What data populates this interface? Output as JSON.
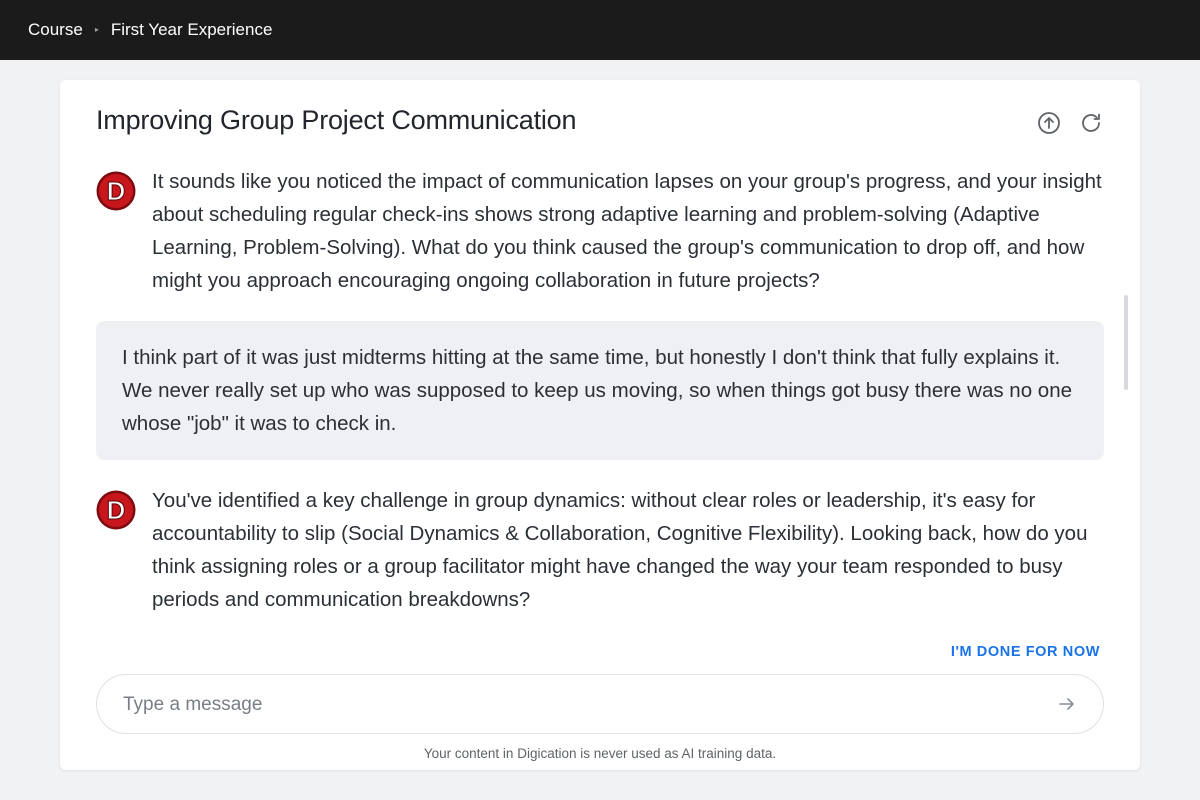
{
  "breadcrumb": {
    "items": [
      "Course",
      "First Year Experience"
    ],
    "separator": "▸"
  },
  "conversation": {
    "title": "Improving Group Project Communication",
    "header_icons": [
      "arrow-up-circle-icon",
      "refresh-icon"
    ],
    "messages": [
      {
        "role": "assistant",
        "avatar": "D",
        "text": "It sounds like you noticed the impact of communication lapses on your group's progress, and your insight about scheduling regular check-ins shows strong adaptive learning and problem-solving (Adaptive Learning, Problem-Solving). What do you think caused the group's communication to drop off, and how might you approach encouraging ongoing collaboration in future projects?"
      },
      {
        "role": "user",
        "text": "I think part of it was just midterms hitting at the same time, but honestly I don't think that fully explains it. We never really set up who was supposed to keep us moving, so when things got busy there was no one whose \"job\" it was to check in."
      },
      {
        "role": "assistant",
        "avatar": "D",
        "text": "You've identified a key challenge in group dynamics: without clear roles or leadership, it's easy for accountability to slip (Social Dynamics & Collaboration, Cognitive Flexibility). Looking back, how do you think assigning roles or a group facilitator might have changed the way your team responded to busy periods and communication breakdowns?"
      }
    ]
  },
  "actions": {
    "done_label": "I'M DONE FOR NOW"
  },
  "composer": {
    "placeholder": "Type a message",
    "value": "",
    "send_icon": "arrow-right-icon"
  },
  "footer": {
    "notice": "Your content in Digication is never used as AI training data."
  },
  "colors": {
    "topbar": "#1b1b1b",
    "accent": "#1a73e8",
    "avatar": "#c8161d",
    "user_bubble": "#eef0f3"
  }
}
